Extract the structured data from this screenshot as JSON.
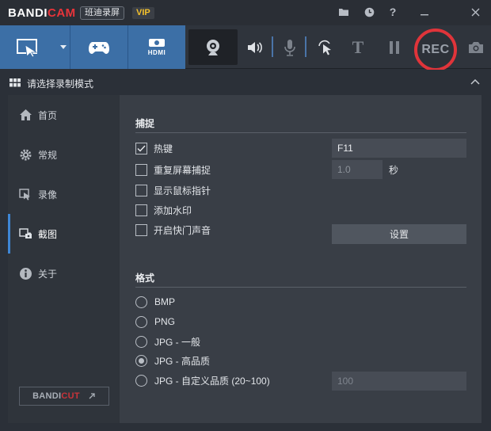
{
  "titlebar": {
    "brand_a": "BANDI",
    "brand_b": "CAM",
    "brand_cn": "班迪录屏",
    "vip": "VIP",
    "icons": [
      "folder-icon",
      "clock-icon",
      "help-icon",
      "minimize-icon",
      "close-icon"
    ]
  },
  "toolbar": {
    "modes": [
      "screen-area-mode",
      "game-mode",
      "hdmi-mode"
    ],
    "hdmi_label": "HDMI",
    "tools": [
      "webcam-icon",
      "speaker-icon",
      "microphone-icon",
      "cursor-click-icon",
      "text-icon",
      "pause-icon",
      "camera-icon"
    ],
    "text_glyph": "T",
    "rec_label": "REC"
  },
  "modebar": {
    "title": "请选择录制模式"
  },
  "sidebar": {
    "items": [
      {
        "label": "首页",
        "icon": "home-icon"
      },
      {
        "label": "常规",
        "icon": "gear-icon"
      },
      {
        "label": "录像",
        "icon": "video-icon"
      },
      {
        "label": "截图",
        "icon": "screenshot-icon"
      },
      {
        "label": "关于",
        "icon": "info-icon"
      }
    ],
    "active_index": 3,
    "bandicut_a": "BANDI",
    "bandicut_b": "CUT"
  },
  "capture": {
    "title": "捕捉",
    "hotkey_label": "热键",
    "hotkey_checked": true,
    "hotkey_value": "F11",
    "repeat_label": "重复屏幕捕捉",
    "repeat_checked": false,
    "repeat_value": "1.0",
    "repeat_unit": "秒",
    "cursor_label": "显示鼠标指针",
    "cursor_checked": false,
    "watermark_label": "添加水印",
    "watermark_checked": false,
    "shutter_label": "开启快门声音",
    "shutter_checked": false,
    "settings_button": "设置"
  },
  "format": {
    "title": "格式",
    "options": [
      "BMP",
      "PNG",
      "JPG - 一般",
      "JPG - 高品质",
      "JPG - 自定义品质 (20~100)"
    ],
    "selected_index": 3,
    "custom_quality_value": "100"
  },
  "colors": {
    "accent": "#3c6fa6",
    "rec_ring": "#e0343a",
    "vip": "#f3c02c",
    "active_bar": "#3e86d5"
  }
}
